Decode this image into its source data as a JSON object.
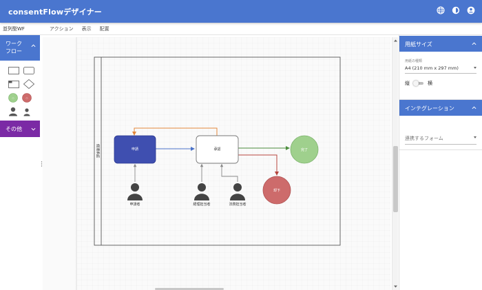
{
  "app": {
    "title": "consentFlowデザイナー"
  },
  "appbar_icons": [
    "globe-icon",
    "theme-icon",
    "account-icon"
  ],
  "menubar": {
    "doc_name": "並列型WF",
    "items": [
      "アクション",
      "表示",
      "配置"
    ]
  },
  "palette": {
    "workflow_label_line1": "ワーク",
    "workflow_label_line2": "フロー",
    "other_label": "その他",
    "shapes": [
      "rectangle-shape",
      "rounded-rectangle-shape",
      "tab-rectangle-shape",
      "diamond-shape",
      "green-circle-shape",
      "red-circle-shape",
      "person-shape",
      "person-small-shape"
    ]
  },
  "diagram": {
    "lane_label": "経理承認",
    "nodes": {
      "apply": "申請",
      "approve": "承認",
      "done": "完了",
      "reject": "却下"
    },
    "actors": {
      "applicant": "申請者",
      "accounting": "経理担当者",
      "legal": "法務担当者"
    }
  },
  "right_panel": {
    "paper": {
      "header": "用紙サイズ",
      "type_label": "用紙の種類",
      "type_value": "A4 (210 mm x 297 mm)",
      "portrait": "縦",
      "landscape": "横",
      "landscape_on": false
    },
    "integration": {
      "header": "インテグレーション",
      "form_placeholder": "連携するフォーム"
    }
  },
  "colors": {
    "primary": "#4a76cf",
    "purple": "#7b2aa5",
    "node_apply": "#3f4fb0",
    "node_done": "#9fd08d",
    "node_reject": "#cd6b6b",
    "edge_orange": "#e2873b",
    "edge_blue": "#4a72c9",
    "edge_green": "#4d8f3e",
    "edge_red": "#b5443c"
  }
}
